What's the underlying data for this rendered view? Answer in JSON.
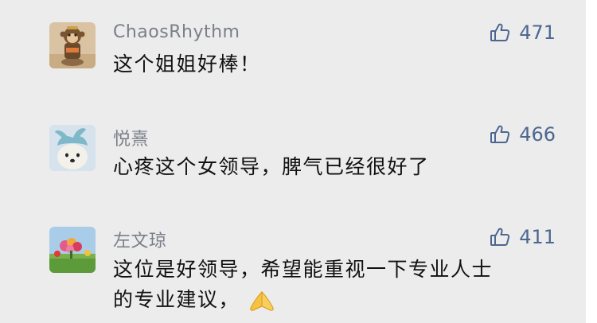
{
  "comments": [
    {
      "username": "ChaosRhythm",
      "text": "这个姐姐好棒！",
      "likes": "471",
      "avatar_icon": "monkey-figure-avatar"
    },
    {
      "username": "悦熹",
      "text": "心疼这个女领导，脾气已经很好了",
      "likes": "466",
      "avatar_icon": "dog-bunny-ears-avatar"
    },
    {
      "username": "左文琼",
      "text_line1": "这位是好领导，希望能重视一下专业人士",
      "text_line2": "的专业建议，",
      "likes": "411",
      "avatar_icon": "flower-garden-avatar",
      "emoji": "praying-hands-emoji"
    }
  ],
  "colors": {
    "background": "#ececec",
    "username": "#7a7f88",
    "text": "#111111",
    "like": "#4d6790"
  }
}
